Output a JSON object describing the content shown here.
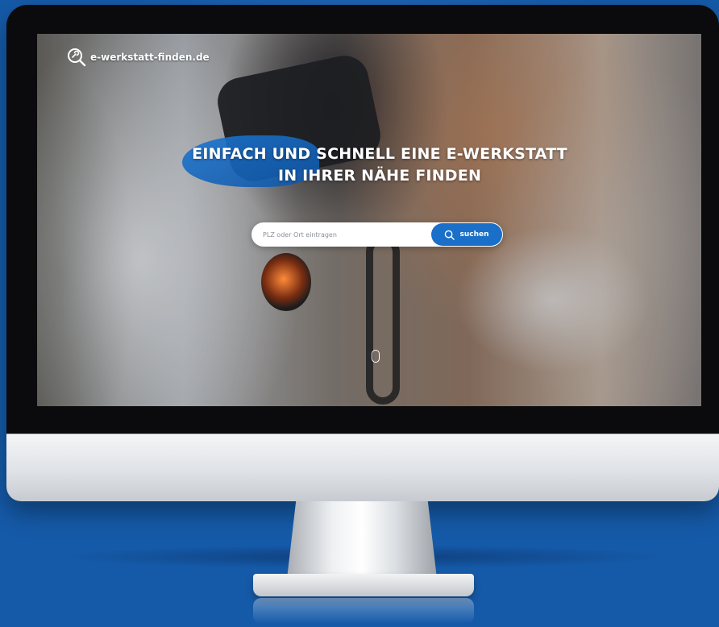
{
  "site": {
    "brand_name": "e-werkstatt-finden.de",
    "logo_icon": "search-wrench-icon"
  },
  "hero": {
    "title": "EINFACH UND SCHNELL EINE E-WERKSTATT IN IHRER NÄHE FINDEN"
  },
  "search": {
    "placeholder": "PLZ oder Ort eintragen",
    "value": "",
    "button_label": "suchen",
    "button_icon": "search-icon"
  },
  "colors": {
    "background": "#155aa8",
    "accent": "#1a6fc8",
    "text_on_dark": "#ffffff"
  },
  "scroll_indicator_icon": "mouse-scroll-icon"
}
